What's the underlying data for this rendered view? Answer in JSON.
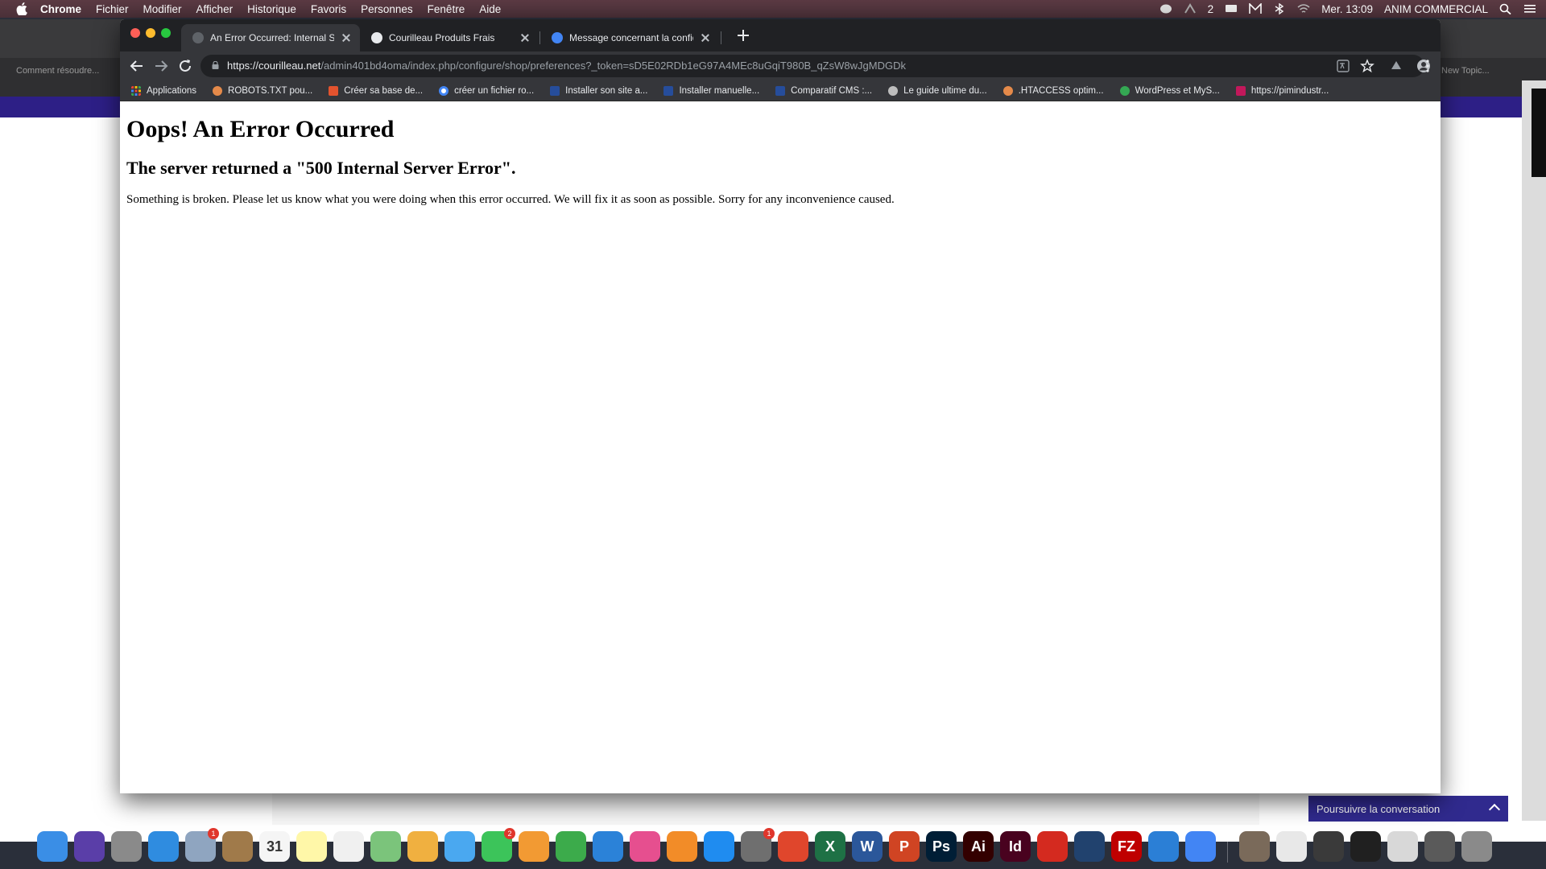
{
  "menubar": {
    "app": "Chrome",
    "items": [
      "Fichier",
      "Modifier",
      "Afficher",
      "Historique",
      "Favoris",
      "Personnes",
      "Fenêtre",
      "Aide"
    ],
    "badge_count": "2",
    "clock": "Mer. 13:09",
    "user": "ANIM COMMERCIAL"
  },
  "background_window": {
    "tab_text": "Comment résoudre...",
    "right_tab_text": "New Topic...",
    "chat_widget_label": "Poursuivre la conversation"
  },
  "tabs": [
    {
      "title": "An Error Occurred: Internal Server Error",
      "fav_color": "#5f6368"
    },
    {
      "title": "Courilleau Produits Frais",
      "fav_color": "#e8eaed"
    },
    {
      "title": "Message concernant la confidentialité",
      "fav_color": "#4285f4"
    }
  ],
  "address": {
    "host": "https://courilleau.net",
    "path": "/admin401bd4oma/index.php/configure/shop/preferences?_token=sD5E02RDb1eG97A4MEc8uGqiT980B_qZsW8wJgMDGDk"
  },
  "bookmarks": [
    {
      "label": "Applications",
      "color": "#f4b400"
    },
    {
      "label": "ROBOTS.TXT pou...",
      "color": "#e58a4a"
    },
    {
      "label": "Créer sa base de...",
      "color": "#e3532e"
    },
    {
      "label": "créer un fichier ro...",
      "color": "#4285f4"
    },
    {
      "label": "Installer son site a...",
      "color": "#264d9b"
    },
    {
      "label": "Installer manuelle...",
      "color": "#264d9b"
    },
    {
      "label": "Comparatif CMS :...",
      "color": "#264d9b"
    },
    {
      "label": "Le guide ultime du...",
      "color": "#bdbdbd"
    },
    {
      "label": ".HTACCESS optim...",
      "color": "#e58a4a"
    },
    {
      "label": "WordPress et MyS...",
      "color": "#34a853"
    },
    {
      "label": "https://pimindustr...",
      "color": "#c2185b"
    }
  ],
  "page": {
    "heading": "Oops! An Error Occurred",
    "subheading": "The server returned a \"500 Internal Server Error\".",
    "message": "Something is broken. Please let us know what you were doing when this error occurred. We will fix it as soon as possible. Sorry for any inconvenience caused."
  },
  "dock": {
    "items": [
      {
        "name": "finder-icon",
        "bg": "#3a8ee6",
        "label": ""
      },
      {
        "name": "siri-icon",
        "bg": "#5a3ea8",
        "label": ""
      },
      {
        "name": "launchpad-icon",
        "bg": "#8a8a8a",
        "label": ""
      },
      {
        "name": "safari-icon",
        "bg": "#2f8ce0",
        "label": ""
      },
      {
        "name": "mail-icon",
        "bg": "#8fa5c0",
        "label": "",
        "badge": "1"
      },
      {
        "name": "contacts-icon",
        "bg": "#a07a4a",
        "label": ""
      },
      {
        "name": "calendar-icon",
        "bg": "#f5f5f5",
        "label": "31"
      },
      {
        "name": "notes-icon",
        "bg": "#fff7a8",
        "label": ""
      },
      {
        "name": "reminders-icon",
        "bg": "#f0f0f0",
        "label": ""
      },
      {
        "name": "maps-icon",
        "bg": "#7bc47b",
        "label": ""
      },
      {
        "name": "photos-icon",
        "bg": "#f0b040",
        "label": ""
      },
      {
        "name": "messages-icon",
        "bg": "#4aa8f0",
        "label": ""
      },
      {
        "name": "facetime-icon",
        "bg": "#3cc45a",
        "label": "",
        "badge": "2"
      },
      {
        "name": "pages-icon",
        "bg": "#f29a33",
        "label": ""
      },
      {
        "name": "numbers-icon",
        "bg": "#3cab4b",
        "label": ""
      },
      {
        "name": "keynote-icon",
        "bg": "#2b82d8",
        "label": ""
      },
      {
        "name": "itunes-icon",
        "bg": "#e64f8f",
        "label": ""
      },
      {
        "name": "books-icon",
        "bg": "#f28c28",
        "label": ""
      },
      {
        "name": "app-store-icon",
        "bg": "#1f8cf0",
        "label": ""
      },
      {
        "name": "system-preferences-icon",
        "bg": "#6f6f6f",
        "label": "",
        "badge": "1"
      },
      {
        "name": "remote-desktop-icon",
        "bg": "#e0462c",
        "label": ""
      },
      {
        "name": "excel-icon",
        "bg": "#1e7145",
        "label": "X"
      },
      {
        "name": "word-icon",
        "bg": "#2b579a",
        "label": "W"
      },
      {
        "name": "powerpoint-icon",
        "bg": "#d04423",
        "label": "P"
      },
      {
        "name": "photoshop-icon",
        "bg": "#001e36",
        "label": "Ps"
      },
      {
        "name": "illustrator-icon",
        "bg": "#330000",
        "label": "Ai"
      },
      {
        "name": "indesign-icon",
        "bg": "#49021f",
        "label": "Id"
      },
      {
        "name": "acrobat-icon",
        "bg": "#d42a1f",
        "label": ""
      },
      {
        "name": "browser-icon",
        "bg": "#21426e",
        "label": ""
      },
      {
        "name": "filezilla-icon",
        "bg": "#bf0000",
        "label": "FZ"
      },
      {
        "name": "cloud-icon",
        "bg": "#2b7fd6",
        "label": ""
      },
      {
        "name": "chrome-icon",
        "bg": "#4285f4",
        "label": ""
      },
      {
        "name": "preview-icon",
        "bg": "#7a6a5a",
        "label": ""
      },
      {
        "name": "document-icon",
        "bg": "#e8e8e8",
        "label": ""
      },
      {
        "name": "screenshot-icon",
        "bg": "#3a3a3a",
        "label": ""
      },
      {
        "name": "window-thumb-icon",
        "bg": "#202020",
        "label": ""
      },
      {
        "name": "window-thumb2-icon",
        "bg": "#d8d8d8",
        "label": ""
      },
      {
        "name": "downloads-icon",
        "bg": "#5a5a5a",
        "label": ""
      },
      {
        "name": "trash-icon",
        "bg": "#8a8a8a",
        "label": ""
      }
    ]
  }
}
